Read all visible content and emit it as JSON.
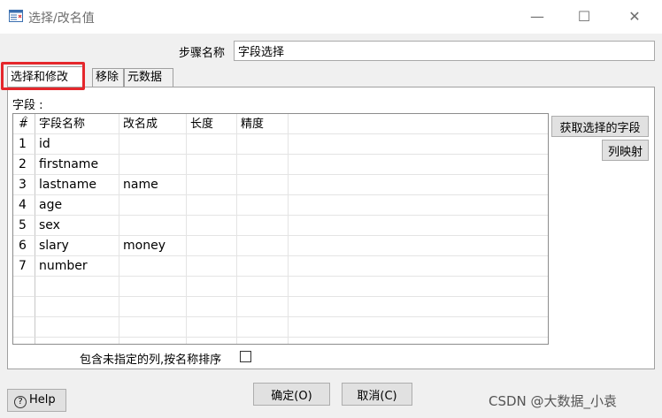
{
  "window": {
    "title": "选择/改名值",
    "minimize": "—",
    "maximize": "☐",
    "close": "✕"
  },
  "step": {
    "label": "步骤名称",
    "value": "字段选择"
  },
  "tabs": [
    {
      "label": "选择和修改",
      "active": true
    },
    {
      "label": "移除",
      "active": false
    },
    {
      "label": "元数据",
      "active": false
    }
  ],
  "fields": {
    "label": "字段 :",
    "columns": [
      "#",
      "字段名称",
      "改名成",
      "长度",
      "精度"
    ],
    "rows": [
      {
        "num": "1",
        "name": "id",
        "rename": "",
        "length": "",
        "precision": ""
      },
      {
        "num": "2",
        "name": "firstname",
        "rename": "",
        "length": "",
        "precision": ""
      },
      {
        "num": "3",
        "name": "lastname",
        "rename": "name",
        "length": "",
        "precision": ""
      },
      {
        "num": "4",
        "name": "age",
        "rename": "",
        "length": "",
        "precision": ""
      },
      {
        "num": "5",
        "name": "sex",
        "rename": "",
        "length": "",
        "precision": ""
      },
      {
        "num": "6",
        "name": "slary",
        "rename": "money",
        "length": "",
        "precision": ""
      },
      {
        "num": "7",
        "name": "number",
        "rename": "",
        "length": "",
        "precision": ""
      }
    ]
  },
  "side_buttons": {
    "get_fields": "获取选择的字段",
    "column_mapping": "列映射"
  },
  "include_unspecified": {
    "label": "包含未指定的列,按名称排序",
    "checked": false
  },
  "footer": {
    "help": "Help",
    "ok": "确定(O)",
    "cancel": "取消(C)"
  },
  "watermark": "CSDN @大数据_小袁",
  "colors": {
    "highlight": "#e5272c",
    "background": "#f0f0f0"
  }
}
